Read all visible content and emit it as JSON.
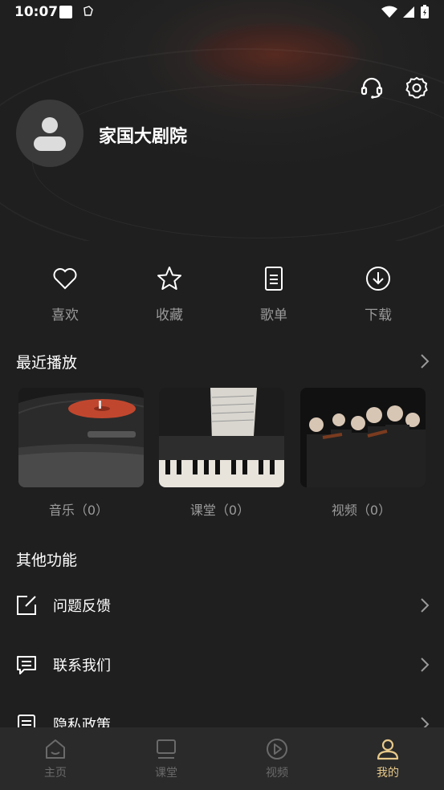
{
  "status": {
    "time": "10:07"
  },
  "profile": {
    "username": "家国大剧院"
  },
  "quick_actions": [
    {
      "label": "喜欢",
      "icon": "heart-icon"
    },
    {
      "label": "收藏",
      "icon": "star-icon"
    },
    {
      "label": "歌单",
      "icon": "document-icon"
    },
    {
      "label": "下载",
      "icon": "download-icon"
    }
  ],
  "recent": {
    "title": "最近播放",
    "cards": [
      {
        "label": "音乐（0）"
      },
      {
        "label": "课堂（0）"
      },
      {
        "label": "视频（0）"
      }
    ]
  },
  "other": {
    "title": "其他功能",
    "items": [
      {
        "label": "问题反馈",
        "icon": "edit-icon"
      },
      {
        "label": "联系我们",
        "icon": "message-icon"
      },
      {
        "label": "隐私政策",
        "icon": "policy-icon"
      }
    ]
  },
  "tabs": [
    {
      "label": "主页",
      "icon": "home-icon",
      "active": false
    },
    {
      "label": "课堂",
      "icon": "screen-icon",
      "active": false
    },
    {
      "label": "视频",
      "icon": "play-icon",
      "active": false
    },
    {
      "label": "我的",
      "icon": "user-icon",
      "active": true
    }
  ],
  "colors": {
    "accent": "#e8c98a",
    "inactive": "#6a6a6a",
    "text_muted": "#9a9a9a"
  }
}
